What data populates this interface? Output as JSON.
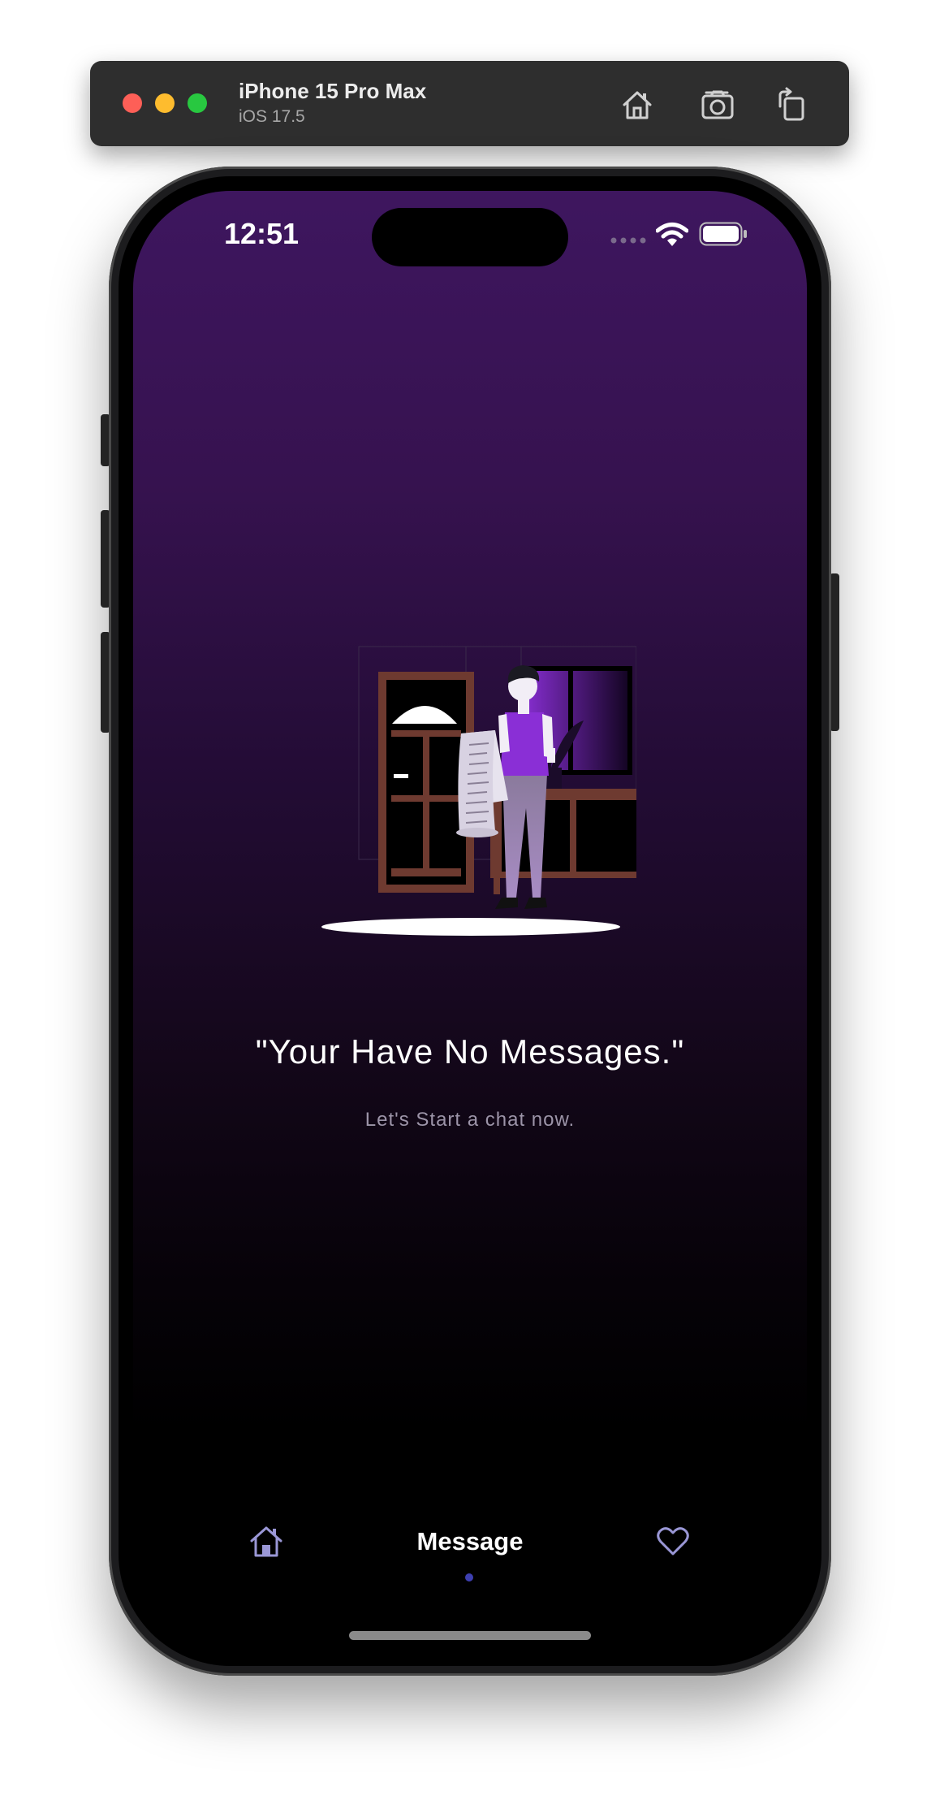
{
  "simulator": {
    "device_name": "iPhone 15 Pro Max",
    "os_version": "iOS 17.5",
    "icons": [
      "home-icon",
      "screenshot-icon",
      "rotate-icon"
    ]
  },
  "status_bar": {
    "time": "12:51",
    "icons": [
      "signal-dots-icon",
      "wifi-icon",
      "battery-icon"
    ]
  },
  "empty_state": {
    "title": "\"Your Have No Messages.\"",
    "subtitle": "Let's Start a chat now."
  },
  "tab_bar": {
    "active_label": "Message",
    "icons": [
      "home-icon",
      "heart-icon"
    ],
    "indicator_color": "#3d3fb0"
  },
  "colors": {
    "background_top": "#3e165f",
    "background_bottom": "#000000",
    "accent_purple": "#8a2fd6"
  }
}
